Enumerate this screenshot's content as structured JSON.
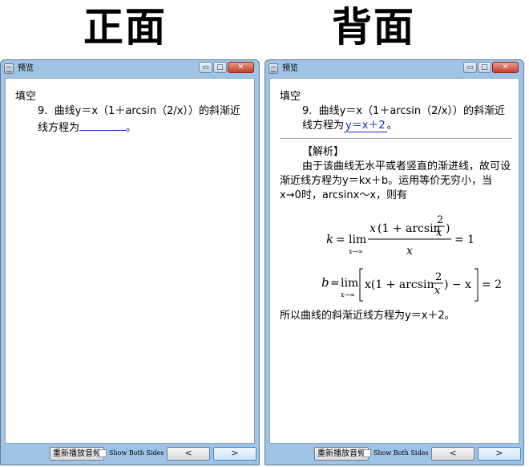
{
  "headings": {
    "front": "正面",
    "back": "背面"
  },
  "window": {
    "title": "预览",
    "controls": {
      "minimize": "▭",
      "maximize": "□",
      "close": "✕"
    }
  },
  "question": {
    "type": "填空",
    "number": "9.",
    "text_before_blank": "曲线y＝x（1＋arcsin（2/x））的斜渐近线方程为",
    "text_after_blank": "。",
    "answer": "y＝x＋2"
  },
  "explanation": {
    "title": "【解析】",
    "body": "由于该曲线无水平或者竖直的渐进线，故可设渐近线方程为y＝kx＋b。运用等价无穷小，当x→0时，arcsinx～x，则有",
    "conclusion": "所以曲线的斜渐近线方程为y＝x＋2。",
    "formula_k": {
      "lhs": "k",
      "lim": "lim",
      "under": "x→∞",
      "num_x": "x",
      "num_open": "(1 + arcsin",
      "frac_num": "2",
      "frac_den": "x",
      "num_close": ")",
      "den": "x",
      "result": "= 1"
    },
    "formula_b": {
      "lhs": "b",
      "lim": "lim",
      "under": "x→∞",
      "body_left": "x(1 + arcsin",
      "frac_num": "2",
      "frac_den": "x",
      "body_right": ") − x",
      "result": "= 2"
    }
  },
  "footer": {
    "replay_label": "重新播放音频",
    "show_both_label": "Show Both Sides",
    "show_both_checked": false,
    "prev_label": "<",
    "next_label": ">"
  },
  "colors": {
    "answer_blue": "#1a2fb0",
    "frame_blue": "#9fc3e4",
    "close_red": "#c4402c"
  }
}
